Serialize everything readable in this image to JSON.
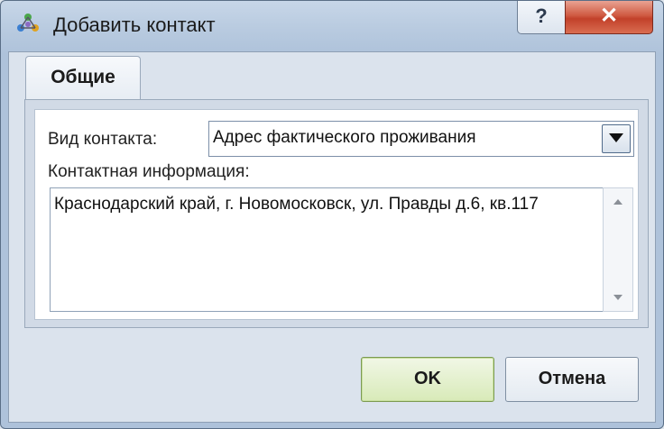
{
  "window": {
    "title": "Добавить контакт",
    "help_label": "?",
    "close_label": "✕",
    "icon": "contacts-app-icon"
  },
  "tabs": [
    {
      "label": "Общие",
      "active": true
    }
  ],
  "form": {
    "contact_type_label": "Вид контакта:",
    "contact_type_value": "Адрес фактического проживания",
    "contact_info_label": "Контактная информация:",
    "contact_info_value": "Краснодарский край, г. Новомосковск, ул. Правды д.6, кв.117"
  },
  "buttons": {
    "ok_label": "OK",
    "cancel_label": "Отмена"
  },
  "colors": {
    "ok_button": "#d8eab8",
    "close_button": "#c2412a"
  }
}
